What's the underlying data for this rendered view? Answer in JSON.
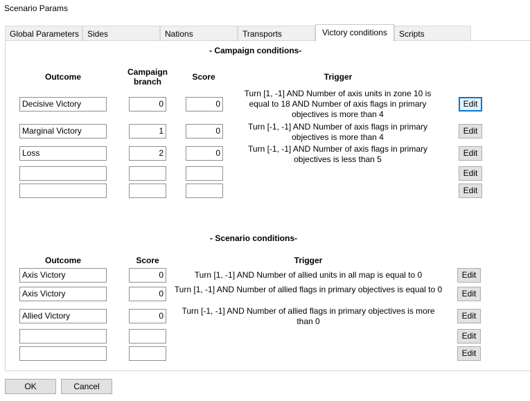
{
  "window": {
    "title": "Scenario Params"
  },
  "tabs": [
    {
      "label": "Global Parameters"
    },
    {
      "label": "Sides"
    },
    {
      "label": "Nations"
    },
    {
      "label": "Transports"
    },
    {
      "label": "Victory conditions",
      "active": true
    },
    {
      "label": "Scripts"
    }
  ],
  "campaign": {
    "section_title": "- Campaign conditions-",
    "headers": {
      "outcome": "Outcome",
      "branch": "Campaign branch",
      "score": "Score",
      "trigger": "Trigger"
    },
    "rows": [
      {
        "outcome": "Decisive Victory",
        "branch": "0",
        "score": "0",
        "trigger": "Turn [1, -1] AND Number of axis units in zone 10 is equal to 18 AND Number of axis flags in primary objectives is more than 4",
        "edit": "Edit"
      },
      {
        "outcome": "Marginal Victory",
        "branch": "1",
        "score": "0",
        "trigger": "Turn [-1, -1] AND Number of axis flags in primary objectives is more than 4",
        "edit": "Edit"
      },
      {
        "outcome": "Loss",
        "branch": "2",
        "score": "0",
        "trigger": "Turn [-1, -1] AND Number of axis flags in primary objectives is less than 5",
        "edit": "Edit"
      },
      {
        "outcome": "",
        "branch": "",
        "score": "",
        "trigger": "",
        "edit": "Edit"
      },
      {
        "outcome": "",
        "branch": "",
        "score": "",
        "trigger": "",
        "edit": "Edit"
      }
    ]
  },
  "scenario": {
    "section_title": "- Scenario conditions-",
    "headers": {
      "outcome": "Outcome",
      "score": "Score",
      "trigger": "Trigger"
    },
    "rows": [
      {
        "outcome": "Axis Victory",
        "score": "0",
        "trigger": "Turn [1, -1] AND Number of allied units in all map is equal to 0",
        "edit": "Edit"
      },
      {
        "outcome": "Axis Victory",
        "score": "0",
        "trigger": "Turn [1, -1] AND Number of allied flags in primary objectives is equal to 0",
        "edit": "Edit"
      },
      {
        "outcome": "Allied Victory",
        "score": "0",
        "trigger": "Turn [-1, -1] AND Number of allied flags in primary objectives is more than 0",
        "edit": "Edit"
      },
      {
        "outcome": "",
        "score": "",
        "trigger": "",
        "edit": "Edit"
      },
      {
        "outcome": "",
        "score": "",
        "trigger": "",
        "edit": "Edit"
      }
    ]
  },
  "footer": {
    "ok_label": "OK",
    "cancel_label": "Cancel"
  }
}
